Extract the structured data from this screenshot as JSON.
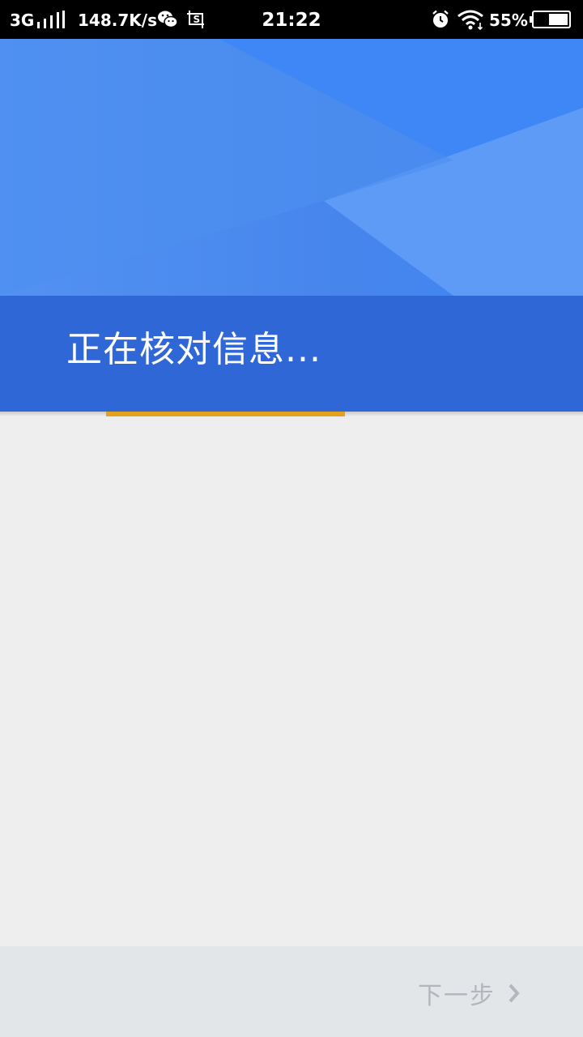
{
  "status_bar": {
    "network": "3G",
    "speed": "148.7K/s",
    "time": "21:22",
    "battery": "55%",
    "icons": [
      "signal-icon",
      "wechat-icon",
      "screenshot-icon",
      "alarm-icon",
      "wifi-icon",
      "battery-icon"
    ]
  },
  "header": {
    "title": "正在核对信息..."
  },
  "progress": {
    "fraction": 0.41,
    "color": "#e2a21b"
  },
  "footer": {
    "next_label": "下一步"
  },
  "colors": {
    "header_primary": "#4a88ee",
    "header_band": "#2f67d6",
    "background": "#eeeeee",
    "footer_background": "#e3e6e9",
    "disabled_text": "#b3b6ba"
  }
}
